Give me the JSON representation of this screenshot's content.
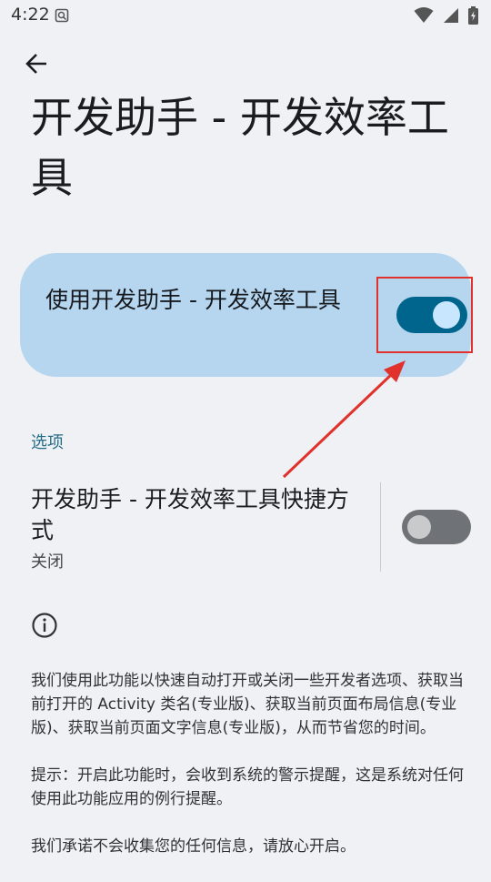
{
  "status_bar": {
    "time": "4:22",
    "icons": [
      "screenshot-notification-icon",
      "wifi-icon",
      "signal-icon",
      "battery-icon"
    ]
  },
  "page": {
    "back_icon": "arrow-left-icon",
    "title": "开发助手 - 开发效率工具"
  },
  "main_toggle": {
    "label": "使用开发助手 - 开发效率工具",
    "state": "on"
  },
  "options": {
    "header": "选项",
    "shortcut": {
      "title": "开发助手 - 开发效率工具快捷方式",
      "summary": "关闭",
      "state": "off"
    }
  },
  "footer": {
    "icon": "info-icon",
    "paragraph1": "我们使用此功能以快速自动打开或关闭一些开发者选项、获取当前打开的 Activity 类名(专业版)、获取当前页面布局信息(专业版)、获取当前页面文字信息(专业版)，从而节省您的时间。",
    "paragraph2": "提示：开启此功能时，会收到系统的警示提醒，这是系统对任何使用此功能应用的例行提醒。",
    "paragraph3": "我们承诺不会收集您的任何信息，请放心开启。"
  },
  "colors": {
    "card_bg": "#b6d6f0",
    "switch_on_track": "#00658d",
    "switch_on_thumb": "#c9e6ff",
    "switch_off_track": "#6f7276",
    "accent_header": "#256c88",
    "annotation_red": "#e0312c"
  }
}
